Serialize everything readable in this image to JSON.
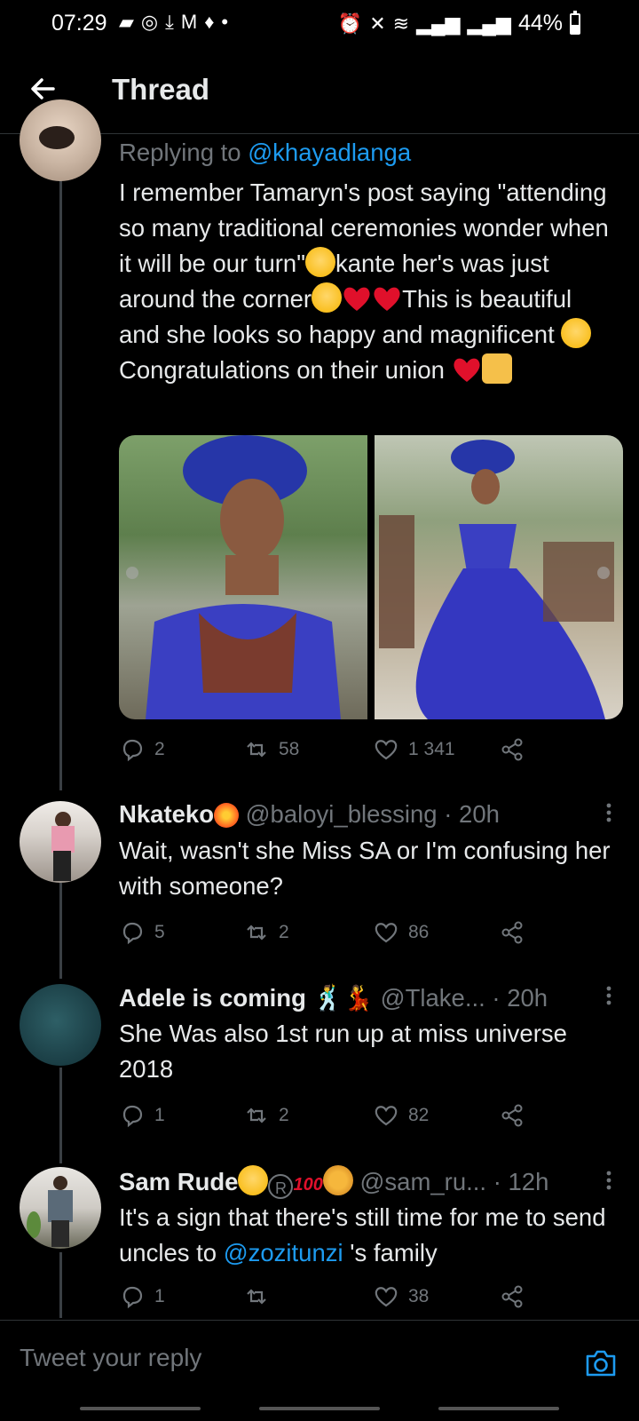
{
  "status": {
    "time": "07:29",
    "battery": "44%"
  },
  "header": {
    "title": "Thread"
  },
  "tweet1": {
    "replying_prefix": "Replying to",
    "replying_handle": "@khayadlanga",
    "text_1": "I remember Tamaryn's post saying \"attending so many traditional ceremonies wonder when it will be our turn\"",
    "text_2": "kante her's was just around the corner",
    "text_3": "This is beautiful and she looks so happy and magnificent",
    "text_4": "Congratulations on their union",
    "replies": "2",
    "retweets": "58",
    "likes": "1 341"
  },
  "tweet2": {
    "name": "Nkateko",
    "handle": "@baloyi_blessing",
    "time": "· 20h",
    "text": "Wait, wasn't she Miss SA or I'm confusing her with someone?",
    "replies": "5",
    "retweets": "2",
    "likes": "86"
  },
  "tweet3": {
    "name": "Adele is coming",
    "handle": "@Tlake...",
    "time": "· 20h",
    "text": "She Was also 1st run up at miss universe 2018",
    "replies": "1",
    "retweets": "2",
    "likes": "82"
  },
  "tweet4": {
    "name": "Sam Rude",
    "handle": "@sam_ru...",
    "time": "· 12h",
    "text_prefix": "It's a sign that there's still time for me to send uncles to",
    "mention": "@zozitunzi",
    "text_suffix": "'s family",
    "replies": "1",
    "likes": "38"
  },
  "reply_box": {
    "placeholder": "Tweet your reply"
  },
  "colors": {
    "link": "#1d9bf0",
    "muted": "#71767b",
    "heart": "#f91880"
  },
  "icons": [
    "back-arrow-icon",
    "reply-icon",
    "retweet-icon",
    "like-icon",
    "share-icon",
    "more-icon",
    "camera-icon"
  ]
}
